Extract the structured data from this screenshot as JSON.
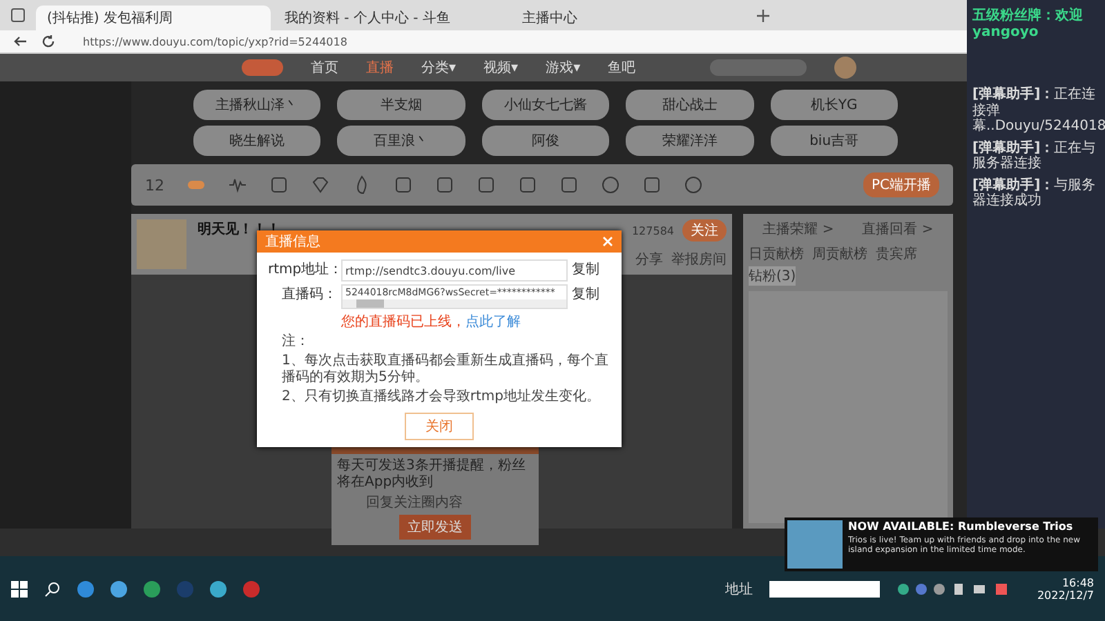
{
  "browser": {
    "tabs": [
      {
        "title": "(抖钻推) 发包福利周",
        "selected": true
      },
      {
        "title": "我的资料 - 个人中心 - 斗鱼",
        "selected": false
      },
      {
        "title": "主播中心",
        "selected": false
      }
    ],
    "url": "https://www.douyu.com/topic/yxp?rid=5244018"
  },
  "site_nav": {
    "items": [
      {
        "label": "首页",
        "selected": false
      },
      {
        "label": "直播",
        "selected": true
      },
      {
        "label": "分类▾",
        "selected": false
      },
      {
        "label": "视频▾",
        "selected": false
      },
      {
        "label": "游戏▾",
        "selected": false
      },
      {
        "label": "鱼吧",
        "selected": false
      }
    ]
  },
  "anchors": [
    "主播秋山泽丶",
    "半支烟",
    "小仙女七七酱",
    "甜心战士",
    "机长YG",
    "晓生解说",
    "百里浪丶",
    "阿俊",
    "荣耀洋洋",
    "biu吉哥"
  ],
  "toolbar": {
    "count": "12",
    "start_button": "PC端开播"
  },
  "room": {
    "title": "明天见！！！",
    "followers": "127584",
    "follow_button": "关注",
    "share": "分享",
    "report": "举报房间"
  },
  "live_modal": {
    "title": "直播信息",
    "rtmp_label": "rtmp地址：",
    "rtmp_value": "rtmp://sendtc3.douyu.com/live",
    "code_label": "直播码：",
    "code_value": "5244018rcM8dMG6?wsSecret=************",
    "rtmp_copy": "复制",
    "code_copy": "复制",
    "warning": "您的直播码已上线，",
    "warning_link": "点此了解",
    "notes": [
      "注：",
      "1、每次点击获取直播码都会重新生成直播码，每个直播码的有效期为5分钟。",
      "2、只有切换直播线路才会导致rtmp地址发生变化。"
    ],
    "close_button": "关闭"
  },
  "reminder_popup": {
    "text": "每天可发送3条开播提醒，粉丝将在App内收到",
    "placeholder": "回复关注圈内容",
    "send_button": "立即发送"
  },
  "chat_panel": {
    "links": [
      "主播荣耀 >",
      "直播回看 >"
    ],
    "tabs": [
      {
        "label": "日贡献榜",
        "selected": false
      },
      {
        "label": "周贡献榜",
        "selected": false
      },
      {
        "label": "贵宾席",
        "selected": false
      },
      {
        "label": "钻粉(3)",
        "selected": true
      }
    ]
  },
  "stream_overlay": {
    "banner": "五级粉丝牌：欢迎yangoyo",
    "messages": [
      {
        "sender": "[弹幕助手]：",
        "text": "正在连接弹幕..Douyu/5244018"
      },
      {
        "sender": "[弹幕助手]：",
        "text": "正在与服务器连接"
      },
      {
        "sender": "[弹幕助手]：",
        "text": "与服务器连接成功"
      }
    ]
  },
  "notification": {
    "title": "NOW AVAILABLE: Rumbleverse Trios",
    "body": "Trios is live! Team up with friends and drop into the new island expansion in the limited time mode."
  },
  "taskbar": {
    "address_label": "地址",
    "time": "16:48",
    "date": "2022/12/7"
  }
}
